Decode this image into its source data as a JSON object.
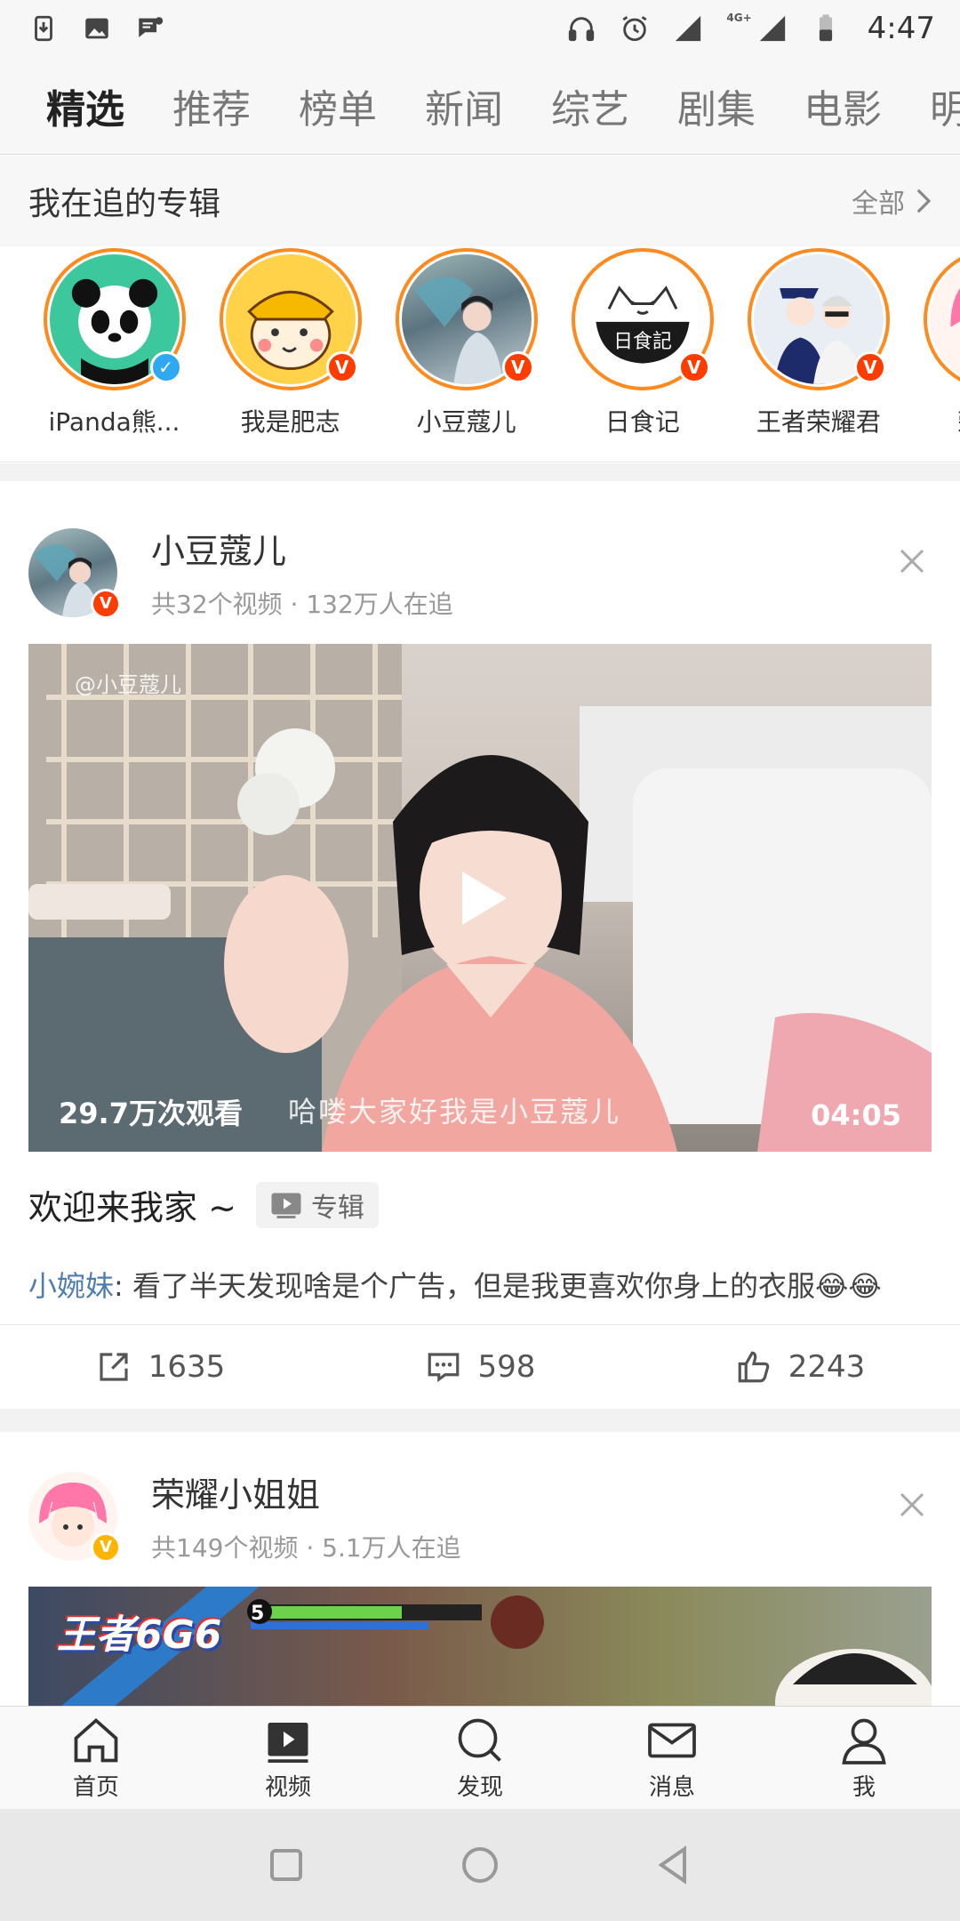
{
  "status_bar": {
    "time": "4:47",
    "network": "4G+",
    "icons": [
      "download-icon",
      "image-icon",
      "message-icon",
      "headphones-icon",
      "alarm-icon",
      "signal-icon",
      "battery-icon"
    ]
  },
  "channel_tabs": [
    {
      "label": "精选",
      "active": true
    },
    {
      "label": "推荐",
      "active": false
    },
    {
      "label": "榜单",
      "active": false
    },
    {
      "label": "新闻",
      "active": false
    },
    {
      "label": "综艺",
      "active": false
    },
    {
      "label": "剧集",
      "active": false
    },
    {
      "label": "电影",
      "active": false
    },
    {
      "label": "明",
      "active": false
    }
  ],
  "following": {
    "title": "我在追的专辑",
    "all_label": "全部",
    "items": [
      {
        "name": "iPanda熊...",
        "badge": "blue"
      },
      {
        "name": "我是肥志",
        "badge": "orange"
      },
      {
        "name": "小豆蔻儿",
        "badge": "orange"
      },
      {
        "name": "日食记",
        "badge": "orange"
      },
      {
        "name": "王者荣耀君",
        "badge": "orange"
      },
      {
        "name": "荣耀小",
        "badge": "orange"
      }
    ]
  },
  "feed": [
    {
      "user": "小豆蔻儿",
      "meta": "共32个视频 · 132万人在追",
      "video": {
        "watermark": "@小豆蔻儿",
        "views": "29.7万次观看",
        "subtitle": "哈喽大家好我是小豆蔻儿",
        "duration": "04:05"
      },
      "title": "欢迎来我家 ~",
      "album_tag": "专辑",
      "comment_user": "小婉妹",
      "comment_text": ": 看了半天发现啥是个广告，但是我更喜欢你身上的衣服😂😂",
      "shares": "1635",
      "comments": "598",
      "likes": "2243"
    },
    {
      "user": "荣耀小姐姐",
      "meta": "共149个视频 · 5.1万人在追",
      "video": {
        "overlay_text": "王者6G6",
        "level": "5"
      }
    }
  ],
  "bottom_nav": [
    {
      "label": "首页",
      "icon": "home-icon"
    },
    {
      "label": "视频",
      "icon": "video-icon"
    },
    {
      "label": "发现",
      "icon": "discover-icon"
    },
    {
      "label": "消息",
      "icon": "message-icon"
    },
    {
      "label": "我",
      "icon": "profile-icon"
    }
  ],
  "colors": {
    "accent": "#ff8200",
    "link": "#507daf",
    "verified_blue": "#2fa8f2",
    "verified_orange": "#ff3c00"
  }
}
